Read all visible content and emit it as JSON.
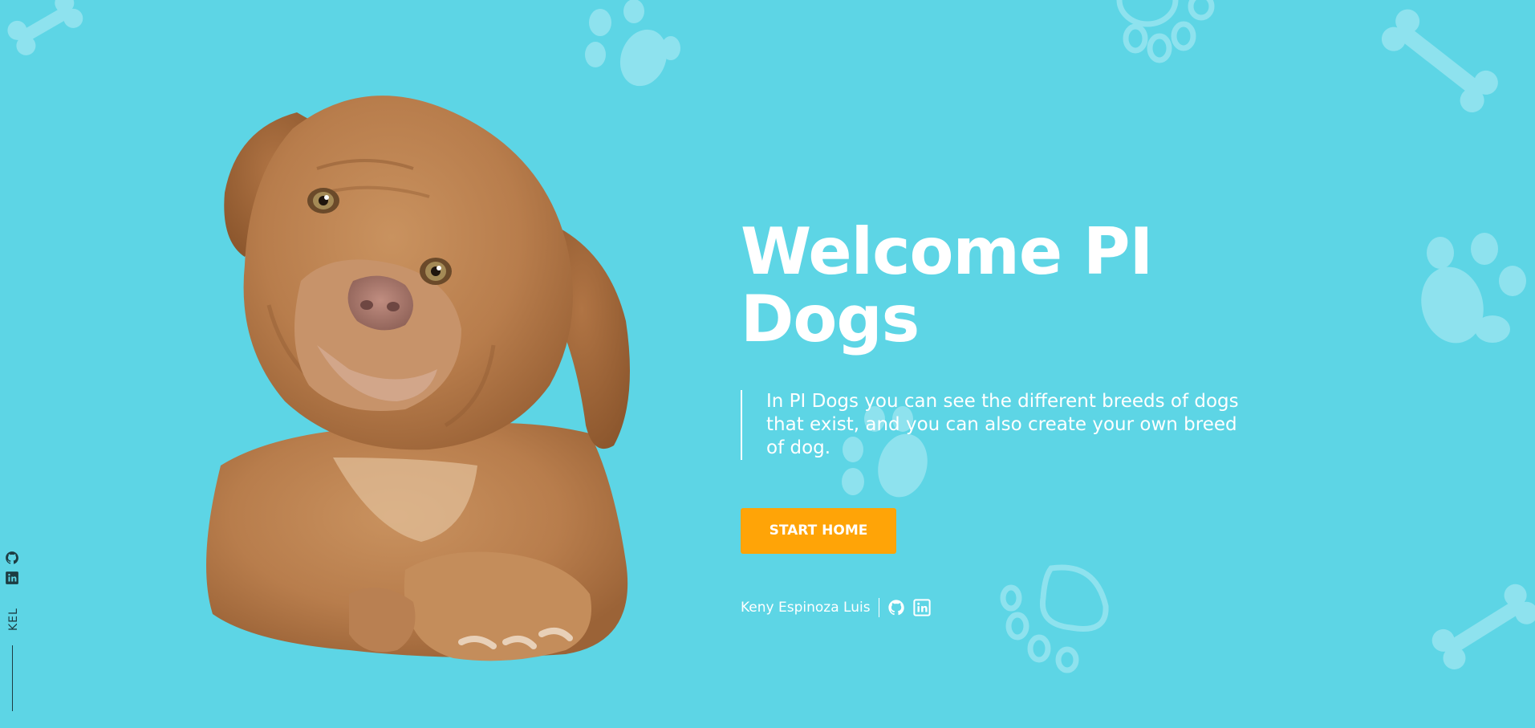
{
  "hero": {
    "title": "Welcome PI Dogs",
    "description": "In PI Dogs you can see the different breeds of dogs that exist, and you can also create your own breed of dog.",
    "start_button_label": "START HOME",
    "image_alt": "puppy"
  },
  "author": {
    "name": "Keny Espinoza Luis",
    "icons": [
      "github-icon",
      "linkedin-icon"
    ]
  },
  "side_bar": {
    "label": "KEL",
    "icons": [
      "github-icon",
      "linkedin-icon"
    ]
  },
  "colors": {
    "background": "#5dd5e5",
    "accent": "#ffa407",
    "text": "#ffffff",
    "decor": "#8ee2ee"
  }
}
